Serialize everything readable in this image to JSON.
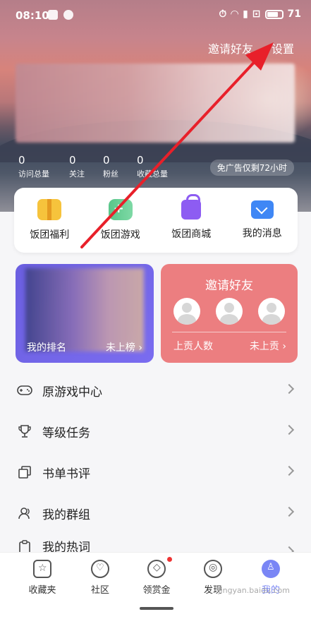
{
  "status_bar": {
    "time": "08:10",
    "battery": "71"
  },
  "header": {
    "invite_link": "邀请好友",
    "settings_link": "设置"
  },
  "stats": [
    {
      "value": "0",
      "label": "访问总量"
    },
    {
      "value": "0",
      "label": "关注"
    },
    {
      "value": "0",
      "label": "粉丝"
    },
    {
      "value": "0",
      "label": "收藏总量"
    }
  ],
  "ad_pill": "免广告仅剩72小时",
  "quick_actions": [
    {
      "label": "饭团福利",
      "icon": "gift-chest-icon"
    },
    {
      "label": "饭团游戏",
      "icon": "gamepad-icon"
    },
    {
      "label": "饭团商城",
      "icon": "shopping-bag-icon"
    },
    {
      "label": "我的消息",
      "icon": "mail-icon"
    }
  ],
  "rank_card": {
    "left": "我的排名",
    "right": "未上榜"
  },
  "invite_card": {
    "title": "邀请好友",
    "left": "上贡人数",
    "right": "未上贡"
  },
  "menu": [
    {
      "label": "原游戏中心",
      "icon": "gamepad-outline-icon"
    },
    {
      "label": "等级任务",
      "icon": "trophy-icon"
    },
    {
      "label": "书单书评",
      "icon": "stack-icon"
    },
    {
      "label": "我的群组",
      "icon": "group-icon"
    },
    {
      "label": "我的热词",
      "icon": "clipboard-icon"
    }
  ],
  "tabs": [
    {
      "label": "收藏夹",
      "icon": "favorites-icon"
    },
    {
      "label": "社区",
      "icon": "community-icon"
    },
    {
      "label": "领赏金",
      "icon": "reward-icon"
    },
    {
      "label": "发现",
      "icon": "discover-icon"
    },
    {
      "label": "我的",
      "icon": "profile-icon"
    }
  ],
  "colors": {
    "accent_purple": "#6b5fe0",
    "invite_red": "#ec7e80",
    "arrow_red": "#e8202a",
    "active_tab": "#7a86f5"
  },
  "watermark": "jingyan.baidu.com"
}
